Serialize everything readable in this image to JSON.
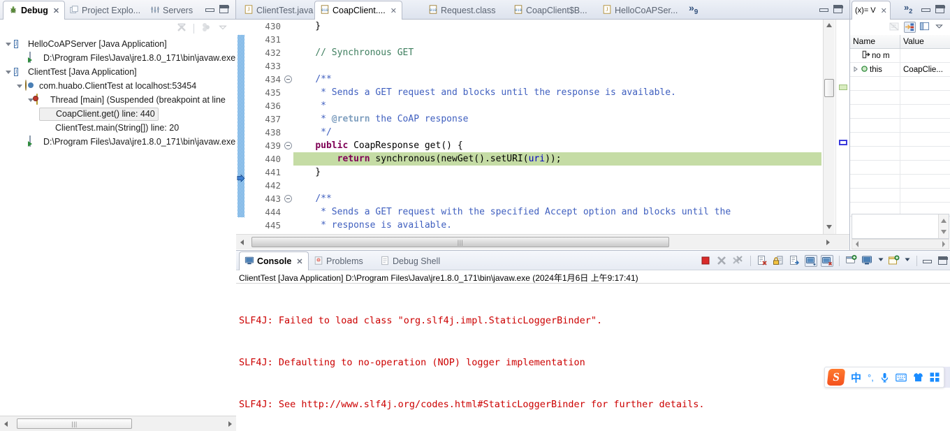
{
  "debug_view": {
    "tabs": [
      {
        "label": "Debug",
        "icon": "bug-icon",
        "active": true,
        "closable": true
      },
      {
        "label": "Project Explo...",
        "icon": "project-explorer-icon",
        "active": false,
        "closable": false
      },
      {
        "label": "Servers",
        "icon": "servers-icon",
        "active": false,
        "closable": false
      }
    ],
    "toolbar": [
      {
        "name": "disconnect-icon",
        "enabled": false
      },
      {
        "name": "view-menu-icon",
        "enabled": false
      },
      {
        "name": "chevron-down-icon",
        "enabled": true
      }
    ],
    "tree": [
      {
        "indent": 0,
        "expander": "open",
        "icon": "java-application-icon",
        "label": "HelloCoAPServer [Java Application]",
        "selected": false
      },
      {
        "indent": 1,
        "expander": "none",
        "icon": "process-icon",
        "label": "D:\\Program Files\\Java\\jre1.8.0_171\\bin\\javaw.exe",
        "selected": false
      },
      {
        "indent": 0,
        "expander": "open",
        "icon": "java-application-icon",
        "label": "ClientTest [Java Application]",
        "selected": false
      },
      {
        "indent": 1,
        "expander": "open",
        "icon": "debug-target-icon",
        "label": "com.huabo.ClientTest at localhost:53454",
        "selected": false
      },
      {
        "indent": 2,
        "expander": "open",
        "icon": "thread-icon",
        "label": "Thread [main] (Suspended (breakpoint at line",
        "selected": false
      },
      {
        "indent": 3,
        "expander": "none",
        "icon": "stack-frame-icon",
        "label": "CoapClient.get() line: 440",
        "selected": true
      },
      {
        "indent": 3,
        "expander": "none",
        "icon": "stack-frame-icon",
        "label": "ClientTest.main(String[]) line: 20",
        "selected": false
      },
      {
        "indent": 1,
        "expander": "none",
        "icon": "process-icon",
        "label": "D:\\Program Files\\Java\\jre1.8.0_171\\bin\\javaw.exe",
        "selected": false
      }
    ]
  },
  "editor": {
    "tabs": [
      {
        "label": "ClientTest.java",
        "icon": "java-file-icon",
        "active": false,
        "closable": false
      },
      {
        "label": "CoapClient....",
        "icon": "class-file-icon",
        "active": true,
        "closable": true
      },
      {
        "label": "Request.class",
        "icon": "class-file-icon",
        "active": false,
        "closable": false
      },
      {
        "label": "CoapClient$B...",
        "icon": "class-file-icon",
        "active": false,
        "closable": false
      },
      {
        "label": "HelloCoAPSer...",
        "icon": "java-file-icon",
        "active": false,
        "closable": false
      }
    ],
    "overflow_label": "»",
    "overflow_count": "9",
    "window_buttons": [
      "minimize-button",
      "maximize-button"
    ],
    "first_line_number": 430,
    "highlighted_line": 440,
    "fold_lines": [
      434,
      439,
      443
    ],
    "lines": [
      {
        "num": 430,
        "segments": [
          {
            "t": "    }",
            "c": "plain"
          }
        ]
      },
      {
        "num": 431,
        "segments": [
          {
            "t": "",
            "c": "plain"
          }
        ]
      },
      {
        "num": 432,
        "segments": [
          {
            "t": "    ",
            "c": "plain"
          },
          {
            "t": "// Synchronous GET",
            "c": "cmt"
          }
        ]
      },
      {
        "num": 433,
        "segments": [
          {
            "t": "",
            "c": "plain"
          }
        ]
      },
      {
        "num": 434,
        "segments": [
          {
            "t": "    ",
            "c": "plain"
          },
          {
            "t": "/**",
            "c": "doc"
          }
        ]
      },
      {
        "num": 435,
        "segments": [
          {
            "t": "     ",
            "c": "plain"
          },
          {
            "t": "* Sends a GET request and blocks until the response is available.",
            "c": "doc"
          }
        ]
      },
      {
        "num": 436,
        "segments": [
          {
            "t": "     ",
            "c": "plain"
          },
          {
            "t": "*",
            "c": "doc"
          }
        ]
      },
      {
        "num": 437,
        "segments": [
          {
            "t": "     ",
            "c": "plain"
          },
          {
            "t": "* ",
            "c": "doc"
          },
          {
            "t": "@return",
            "c": "doctag"
          },
          {
            "t": " the CoAP response",
            "c": "doc"
          }
        ]
      },
      {
        "num": 438,
        "segments": [
          {
            "t": "     ",
            "c": "plain"
          },
          {
            "t": "*/",
            "c": "doc"
          }
        ]
      },
      {
        "num": 439,
        "segments": [
          {
            "t": "    ",
            "c": "plain"
          },
          {
            "t": "public",
            "c": "kw"
          },
          {
            "t": " CoapResponse get() {",
            "c": "plain"
          }
        ]
      },
      {
        "num": 440,
        "segments": [
          {
            "t": "        ",
            "c": "plain"
          },
          {
            "t": "return",
            "c": "kw"
          },
          {
            "t": " synchronous(newGet().setURI(",
            "c": "plain"
          },
          {
            "t": "uri",
            "c": "fld"
          },
          {
            "t": "));",
            "c": "plain"
          }
        ]
      },
      {
        "num": 441,
        "segments": [
          {
            "t": "    }",
            "c": "plain"
          }
        ]
      },
      {
        "num": 442,
        "segments": [
          {
            "t": "",
            "c": "plain"
          }
        ]
      },
      {
        "num": 443,
        "segments": [
          {
            "t": "    ",
            "c": "plain"
          },
          {
            "t": "/**",
            "c": "doc"
          }
        ]
      },
      {
        "num": 444,
        "segments": [
          {
            "t": "     ",
            "c": "plain"
          },
          {
            "t": "* Sends a GET request with the specified Accept option and blocks until the",
            "c": "doc"
          }
        ]
      },
      {
        "num": 445,
        "segments": [
          {
            "t": "     ",
            "c": "plain"
          },
          {
            "t": "* response is available.",
            "c": "doc"
          }
        ]
      }
    ]
  },
  "variables_view": {
    "tabs": [
      {
        "label": "(x)= V",
        "icon": "variables-icon",
        "active": true,
        "closable": true
      }
    ],
    "overflow_label": "»",
    "overflow_count": "2",
    "window_buttons": [
      "minimize-button",
      "maximize-button"
    ],
    "toolbar": [
      {
        "name": "collapse-all-icon",
        "pressed": false,
        "enabled": false
      },
      {
        "name": "show-logical-structure-icon",
        "pressed": true,
        "enabled": true
      },
      {
        "name": "layout-icon",
        "pressed": false,
        "enabled": true
      },
      {
        "name": "view-menu-chevron-icon",
        "pressed": false,
        "enabled": true
      }
    ],
    "columns": [
      "Name",
      "Value"
    ],
    "rows": [
      {
        "expander": "none",
        "icon": "return-value-icon",
        "name": "no m",
        "value": ""
      },
      {
        "expander": "closed",
        "icon": "object-field-icon",
        "name": "this",
        "value": "CoapClie..."
      },
      {
        "expander": "none",
        "icon": "",
        "name": "",
        "value": ""
      },
      {
        "expander": "none",
        "icon": "",
        "name": "",
        "value": ""
      },
      {
        "expander": "none",
        "icon": "",
        "name": "",
        "value": ""
      },
      {
        "expander": "none",
        "icon": "",
        "name": "",
        "value": ""
      },
      {
        "expander": "none",
        "icon": "",
        "name": "",
        "value": ""
      },
      {
        "expander": "none",
        "icon": "",
        "name": "",
        "value": ""
      },
      {
        "expander": "none",
        "icon": "",
        "name": "",
        "value": ""
      },
      {
        "expander": "none",
        "icon": "",
        "name": "",
        "value": ""
      },
      {
        "expander": "none",
        "icon": "",
        "name": "",
        "value": ""
      },
      {
        "expander": "none",
        "icon": "",
        "name": "",
        "value": ""
      }
    ]
  },
  "console_view": {
    "tabs": [
      {
        "label": "Console",
        "icon": "console-icon",
        "active": true,
        "closable": true
      },
      {
        "label": "Problems",
        "icon": "problems-icon",
        "active": false,
        "closable": false
      },
      {
        "label": "Debug Shell",
        "icon": "debug-shell-icon",
        "active": false,
        "closable": false
      }
    ],
    "toolbar": [
      {
        "name": "terminate-icon",
        "pressed": false
      },
      {
        "name": "remove-launch-icon",
        "pressed": false
      },
      {
        "name": "remove-all-launches-icon",
        "pressed": false
      },
      {
        "name": "clear-console-icon",
        "pressed": false
      },
      {
        "name": "scroll-lock-icon",
        "pressed": false
      },
      {
        "name": "word-wrap-icon",
        "pressed": false
      },
      {
        "name": "show-console-on-output-icon",
        "pressed": true
      },
      {
        "name": "show-console-on-error-icon",
        "pressed": true
      },
      {
        "name": "pin-console-icon",
        "pressed": false
      },
      {
        "name": "display-selected-console-icon",
        "pressed": false
      },
      {
        "name": "display-selected-console-chevron-icon",
        "pressed": false
      },
      {
        "name": "open-console-icon",
        "pressed": false
      },
      {
        "name": "open-console-chevron-icon",
        "pressed": false
      },
      {
        "name": "minimize-button",
        "pressed": false
      },
      {
        "name": "maximize-button",
        "pressed": false
      }
    ],
    "header": "ClientTest [Java Application] D:\\Program Files\\Java\\jre1.8.0_171\\bin\\javaw.exe (2024年1月6日 上午9:17:41)",
    "output_color": "#cc0000",
    "output_lines": [
      "SLF4J: Failed to load class \"org.slf4j.impl.StaticLoggerBinder\".",
      "SLF4J: Defaulting to no-operation (NOP) logger implementation",
      "SLF4J: See http://www.slf4j.org/codes.html#StaticLoggerBinder for further details."
    ]
  },
  "ime_toolbar": {
    "logo": "S",
    "items": [
      {
        "name": "language-mode-icon",
        "glyph": "中"
      },
      {
        "name": "punctuation-mode-icon",
        "glyph": "°,"
      },
      {
        "name": "voice-input-icon",
        "glyph": "🎤"
      },
      {
        "name": "soft-keyboard-icon",
        "glyph": "⌨"
      },
      {
        "name": "skin-icon",
        "glyph": "👕"
      },
      {
        "name": "toolbox-icon",
        "glyph": "▦"
      }
    ]
  },
  "theme": {
    "accent": "#3f6fa8",
    "highlight_line": "#c5dca5",
    "console_error": "#cc0000",
    "selection_bg": "#f0f0f0",
    "tab_active_bg": "#ffffff",
    "chrome_bg": "#e7ebf3"
  }
}
